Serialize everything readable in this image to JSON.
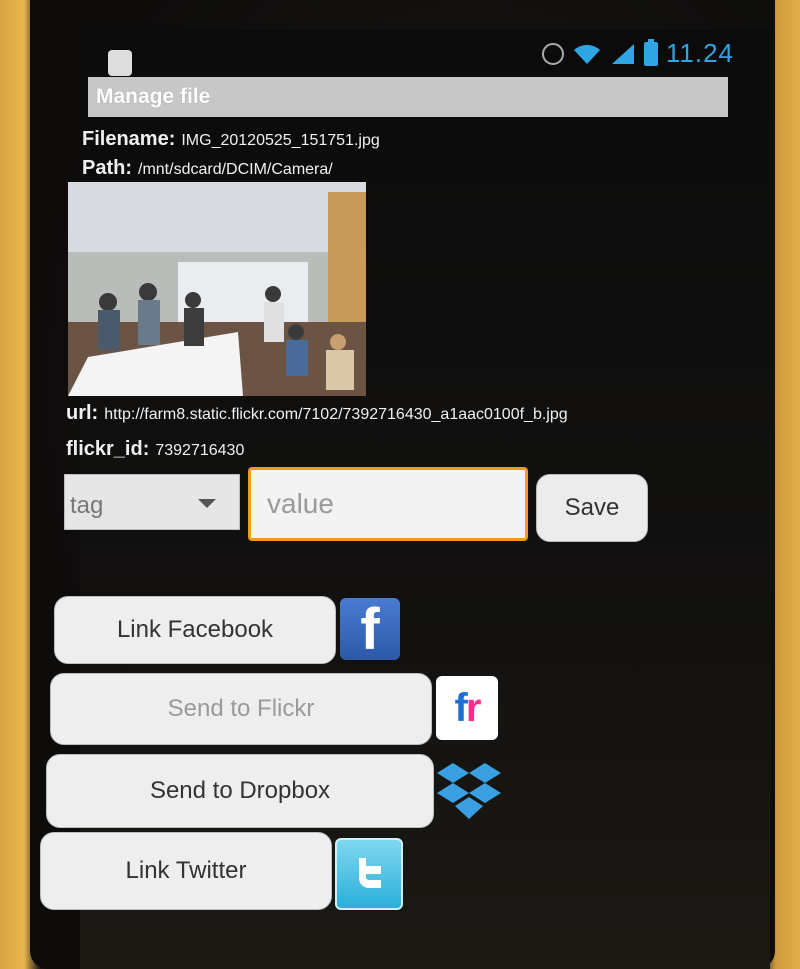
{
  "status_bar": {
    "time": "11.24"
  },
  "title_bar": {
    "title": "Manage file"
  },
  "file_info": {
    "filename_label": "Filename:",
    "filename": "IMG_20120525_151751.jpg",
    "path_label": "Path:",
    "path": "/mnt/sdcard/DCIM/Camera/",
    "url_label": "url:",
    "url": "http://farm8.static.flickr.com/7102/7392716430_a1aac0100f_b.jpg",
    "flickr_id_label": "flickr_id:",
    "flickr_id": "7392716430"
  },
  "tag_editor": {
    "selected_tag": "tag",
    "value_placeholder": "value",
    "save_label": "Save"
  },
  "actions": [
    {
      "label": "Link Facebook",
      "icon": "facebook-icon",
      "enabled": true
    },
    {
      "label": "Send to Flickr",
      "icon": "flickr-icon",
      "enabled": false
    },
    {
      "label": "Send to Dropbox",
      "icon": "dropbox-icon",
      "enabled": true
    },
    {
      "label": "Link Twitter",
      "icon": "twitter-icon",
      "enabled": true
    }
  ],
  "colors": {
    "accent": "#2fa6e3",
    "focus_border": "#f29b1d",
    "title_bar": "#c7c7c7"
  }
}
